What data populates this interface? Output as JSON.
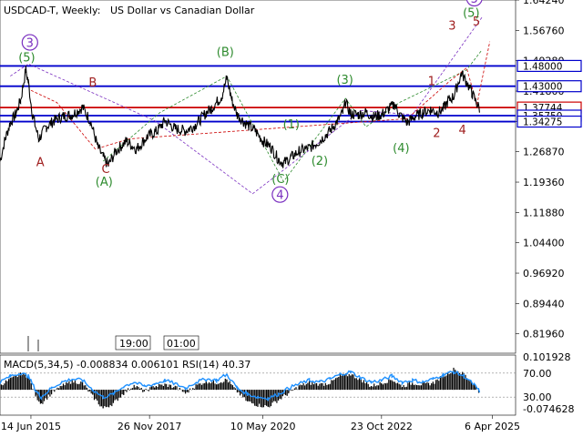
{
  "header": {
    "symbol": "USDCAD-T, Weekly:",
    "description": "US Dollar vs Canadian Dollar"
  },
  "chart_data": {
    "type": "line",
    "ylim": [
      0.7718,
      1.6425
    ],
    "y_ticks": [
      "1.64240",
      "1.56760",
      "1.49280",
      "1.41800",
      "1.34320",
      "1.26870",
      "1.19360",
      "1.11880",
      "1.04400",
      "0.96920",
      "0.89440",
      "0.81960"
    ],
    "x_ticks": [
      {
        "label": "14 Jun 2015",
        "pos": 0.06
      },
      {
        "label": "26 Nov 2017",
        "pos": 0.29
      },
      {
        "label": "10 May 2020",
        "pos": 0.51
      },
      {
        "label": "23 Oct 2022",
        "pos": 0.74
      },
      {
        "label": "6 Apr 2025",
        "pos": 0.955
      }
    ],
    "price_series": [
      [
        0.0,
        1.245
      ],
      [
        0.01,
        1.3
      ],
      [
        0.02,
        1.34
      ],
      [
        0.03,
        1.36
      ],
      [
        0.04,
        1.395
      ],
      [
        0.05,
        1.47
      ],
      [
        0.055,
        1.44
      ],
      [
        0.063,
        1.36
      ],
      [
        0.075,
        1.3
      ],
      [
        0.09,
        1.33
      ],
      [
        0.105,
        1.345
      ],
      [
        0.12,
        1.355
      ],
      [
        0.14,
        1.36
      ],
      [
        0.16,
        1.378
      ],
      [
        0.175,
        1.345
      ],
      [
        0.19,
        1.28
      ],
      [
        0.2,
        1.255
      ],
      [
        0.21,
        1.235
      ],
      [
        0.225,
        1.27
      ],
      [
        0.245,
        1.295
      ],
      [
        0.265,
        1.275
      ],
      [
        0.285,
        1.305
      ],
      [
        0.305,
        1.32
      ],
      [
        0.32,
        1.345
      ],
      [
        0.34,
        1.325
      ],
      [
        0.36,
        1.32
      ],
      [
        0.38,
        1.335
      ],
      [
        0.4,
        1.365
      ],
      [
        0.41,
        1.375
      ],
      [
        0.43,
        1.405
      ],
      [
        0.44,
        1.45
      ],
      [
        0.45,
        1.395
      ],
      [
        0.46,
        1.36
      ],
      [
        0.475,
        1.34
      ],
      [
        0.495,
        1.32
      ],
      [
        0.51,
        1.295
      ],
      [
        0.525,
        1.28
      ],
      [
        0.54,
        1.25
      ],
      [
        0.55,
        1.24
      ],
      [
        0.565,
        1.255
      ],
      [
        0.58,
        1.27
      ],
      [
        0.6,
        1.278
      ],
      [
        0.62,
        1.295
      ],
      [
        0.64,
        1.32
      ],
      [
        0.655,
        1.345
      ],
      [
        0.665,
        1.365
      ],
      [
        0.67,
        1.39
      ],
      [
        0.68,
        1.362
      ],
      [
        0.695,
        1.36
      ],
      [
        0.71,
        1.365
      ],
      [
        0.725,
        1.355
      ],
      [
        0.74,
        1.36
      ],
      [
        0.755,
        1.375
      ],
      [
        0.765,
        1.385
      ],
      [
        0.775,
        1.36
      ],
      [
        0.79,
        1.34
      ],
      [
        0.805,
        1.355
      ],
      [
        0.82,
        1.365
      ],
      [
        0.835,
        1.372
      ],
      [
        0.85,
        1.365
      ],
      [
        0.86,
        1.375
      ],
      [
        0.87,
        1.395
      ],
      [
        0.88,
        1.405
      ],
      [
        0.895,
        1.462
      ],
      [
        0.905,
        1.44
      ],
      [
        0.915,
        1.415
      ],
      [
        0.925,
        1.385
      ],
      [
        0.93,
        1.375
      ]
    ],
    "horizontal_levels": [
      {
        "label": "1.48000",
        "value": 1.48,
        "color": "#0000cc"
      },
      {
        "label": "1.43000",
        "value": 1.43,
        "color": "#0000cc"
      },
      {
        "label": "1.37744",
        "value": 1.3774,
        "color": "#cc0000"
      },
      {
        "label": "1.35750",
        "value": 1.3575,
        "color": "#0000cc"
      },
      {
        "label": "1.34275",
        "value": 1.3428,
        "color": "#0000cc"
      }
    ],
    "dashed_paths": [
      {
        "color": "#7a2fc0",
        "points": [
          [
            0.02,
            1.455
          ],
          [
            0.055,
            1.485
          ],
          [
            0.3,
            1.345
          ],
          [
            0.49,
            1.165
          ],
          [
            0.7,
            1.37
          ],
          [
            0.8,
            1.36
          ],
          [
            0.935,
            1.6
          ]
        ]
      },
      {
        "color": "#2e8b2e",
        "points": [
          [
            0.2,
            1.245
          ],
          [
            0.31,
            1.365
          ],
          [
            0.44,
            1.455
          ],
          [
            0.55,
            1.195
          ],
          [
            0.67,
            1.4
          ],
          [
            0.71,
            1.33
          ],
          [
            0.775,
            1.39
          ],
          [
            0.905,
            1.47
          ],
          [
            0.935,
            1.52
          ]
        ]
      },
      {
        "color": "#cc0000",
        "points": [
          [
            0.06,
            1.42
          ],
          [
            0.11,
            1.39
          ],
          [
            0.185,
            1.275
          ],
          [
            0.25,
            1.3
          ],
          [
            0.79,
            1.35
          ],
          [
            0.87,
            1.44
          ],
          [
            0.905,
            1.475
          ],
          [
            0.925,
            1.385
          ],
          [
            0.95,
            1.54
          ]
        ]
      }
    ],
    "wave_labels": [
      {
        "text": "③",
        "x": 0.058,
        "y": 1.529,
        "color": "#7a2fc0"
      },
      {
        "text": "(5)",
        "x": 0.052,
        "y": 1.491,
        "color": "#2e8b2e"
      },
      {
        "text": "B",
        "x": 0.18,
        "y": 1.429,
        "color": "#a02020"
      },
      {
        "text": "A",
        "x": 0.078,
        "y": 1.233,
        "color": "#a02020"
      },
      {
        "text": "C",
        "x": 0.205,
        "y": 1.216,
        "color": "#a02020"
      },
      {
        "text": "(A)",
        "x": 0.202,
        "y": 1.185,
        "color": "#2e8b2e"
      },
      {
        "text": "(B)",
        "x": 0.437,
        "y": 1.505,
        "color": "#2e8b2e"
      },
      {
        "text": "(1)",
        "x": 0.565,
        "y": 1.326,
        "color": "#2e8b2e"
      },
      {
        "text": "(C)",
        "x": 0.544,
        "y": 1.192,
        "color": "#2e8b2e"
      },
      {
        "text": "④",
        "x": 0.543,
        "y": 1.154,
        "color": "#7a2fc0"
      },
      {
        "text": "(2)",
        "x": 0.62,
        "y": 1.236,
        "color": "#2e8b2e"
      },
      {
        "text": "(3)",
        "x": 0.669,
        "y": 1.436,
        "color": "#2e8b2e"
      },
      {
        "text": "(4)",
        "x": 0.778,
        "y": 1.268,
        "color": "#2e8b2e"
      },
      {
        "text": "1",
        "x": 0.837,
        "y": 1.433,
        "color": "#a02020"
      },
      {
        "text": "2",
        "x": 0.847,
        "y": 1.305,
        "color": "#a02020"
      },
      {
        "text": "3",
        "x": 0.877,
        "y": 1.57,
        "color": "#a02020"
      },
      {
        "text": "4",
        "x": 0.897,
        "y": 1.313,
        "color": "#a02020"
      },
      {
        "text": "5",
        "x": 0.924,
        "y": 1.58,
        "color": "#a02020"
      },
      {
        "text": "(5)",
        "x": 0.914,
        "y": 1.601,
        "color": "#2e8b2e"
      },
      {
        "text": "⑤",
        "x": 0.92,
        "y": 1.638,
        "color": "#7a2fc0"
      }
    ],
    "time_boxes": [
      "19:00",
      "01:00"
    ],
    "indicator": {
      "label": "MACD(5,34,5) -0.008834 0.006101 RSI(14) 40.37",
      "ylim": [
        -0.074628,
        0.101928
      ],
      "y_ticks": [
        "0.101928",
        "70.00",
        "30.00",
        "-0.074628"
      ],
      "histogram": [
        [
          0.0,
          0.015
        ],
        [
          0.02,
          0.03
        ],
        [
          0.04,
          0.045
        ],
        [
          0.055,
          0.04
        ],
        [
          0.07,
          -0.02
        ],
        [
          0.08,
          -0.04
        ],
        [
          0.1,
          -0.01
        ],
        [
          0.12,
          0.01
        ],
        [
          0.14,
          0.025
        ],
        [
          0.16,
          0.02
        ],
        [
          0.18,
          -0.02
        ],
        [
          0.2,
          -0.055
        ],
        [
          0.22,
          -0.04
        ],
        [
          0.24,
          -0.01
        ],
        [
          0.26,
          0.012
        ],
        [
          0.28,
          -0.005
        ],
        [
          0.3,
          0.01
        ],
        [
          0.32,
          0.015
        ],
        [
          0.34,
          0.008
        ],
        [
          0.36,
          -0.01
        ],
        [
          0.38,
          0.012
        ],
        [
          0.4,
          0.025
        ],
        [
          0.42,
          0.02
        ],
        [
          0.44,
          0.03
        ],
        [
          0.46,
          -0.005
        ],
        [
          0.48,
          -0.035
        ],
        [
          0.5,
          -0.045
        ],
        [
          0.52,
          -0.05
        ],
        [
          0.54,
          -0.03
        ],
        [
          0.56,
          -0.01
        ],
        [
          0.58,
          0.01
        ],
        [
          0.6,
          0.02
        ],
        [
          0.62,
          0.015
        ],
        [
          0.64,
          0.02
        ],
        [
          0.66,
          0.04
        ],
        [
          0.68,
          0.045
        ],
        [
          0.7,
          0.03
        ],
        [
          0.72,
          0.01
        ],
        [
          0.74,
          0.02
        ],
        [
          0.76,
          0.03
        ],
        [
          0.78,
          0.01
        ],
        [
          0.8,
          0.02
        ],
        [
          0.82,
          0.015
        ],
        [
          0.84,
          0.02
        ],
        [
          0.86,
          0.04
        ],
        [
          0.88,
          0.06
        ],
        [
          0.9,
          0.045
        ],
        [
          0.92,
          0.015
        ],
        [
          0.93,
          -0.01
        ]
      ],
      "rsi": [
        [
          0.0,
          55
        ],
        [
          0.02,
          65
        ],
        [
          0.04,
          70
        ],
        [
          0.055,
          65
        ],
        [
          0.07,
          40
        ],
        [
          0.08,
          30
        ],
        [
          0.1,
          45
        ],
        [
          0.12,
          55
        ],
        [
          0.14,
          60
        ],
        [
          0.16,
          58
        ],
        [
          0.18,
          42
        ],
        [
          0.2,
          30
        ],
        [
          0.22,
          35
        ],
        [
          0.24,
          48
        ],
        [
          0.26,
          55
        ],
        [
          0.28,
          48
        ],
        [
          0.3,
          52
        ],
        [
          0.32,
          58
        ],
        [
          0.34,
          52
        ],
        [
          0.36,
          45
        ],
        [
          0.38,
          55
        ],
        [
          0.4,
          60
        ],
        [
          0.42,
          58
        ],
        [
          0.44,
          68
        ],
        [
          0.46,
          45
        ],
        [
          0.48,
          35
        ],
        [
          0.5,
          30
        ],
        [
          0.52,
          28
        ],
        [
          0.54,
          35
        ],
        [
          0.56,
          45
        ],
        [
          0.58,
          52
        ],
        [
          0.6,
          58
        ],
        [
          0.62,
          55
        ],
        [
          0.64,
          60
        ],
        [
          0.66,
          68
        ],
        [
          0.68,
          72
        ],
        [
          0.7,
          62
        ],
        [
          0.72,
          55
        ],
        [
          0.74,
          58
        ],
        [
          0.76,
          65
        ],
        [
          0.78,
          55
        ],
        [
          0.8,
          58
        ],
        [
          0.82,
          55
        ],
        [
          0.84,
          60
        ],
        [
          0.86,
          68
        ],
        [
          0.88,
          72
        ],
        [
          0.9,
          65
        ],
        [
          0.92,
          50
        ],
        [
          0.93,
          40
        ]
      ]
    }
  }
}
